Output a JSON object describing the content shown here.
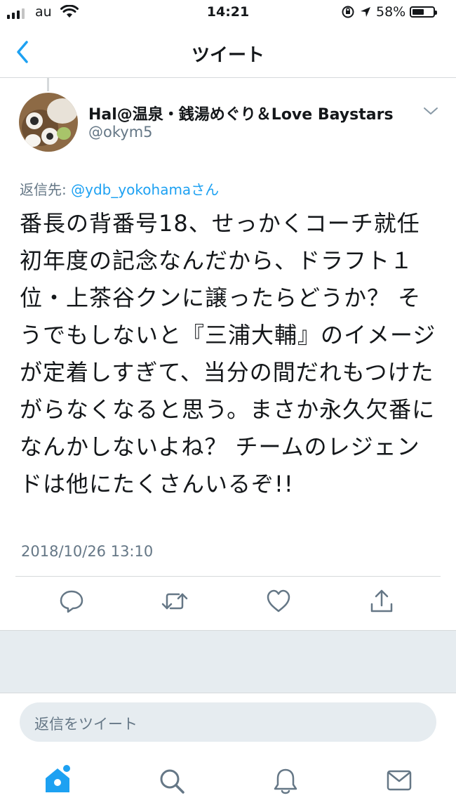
{
  "status_bar": {
    "carrier": "au",
    "time": "14:21",
    "battery": "58%",
    "battery_level": 0.58
  },
  "nav": {
    "title": "ツイート",
    "back_icon": "chevron-left-icon"
  },
  "tweet": {
    "display_name": "Hal@温泉・銭湯めぐり＆Love Baystars",
    "handle": "@okym5",
    "reply_prefix": "返信先:",
    "reply_target": "@ydb_yokohama",
    "reply_suffix": "さん",
    "text": "番長の背番号18、せっかくコーチ就任初年度の記念なんだから、ドラフト１位・上茶谷クンに譲ったらどうか？ そうでもしないと『三浦大輔』のイメージが定着しすぎて、当分の間だれもつけたがらなくなると思う。まさか永久欠番になんかしないよね？ チームのレジェンドは他にたくさんいるぞ!!",
    "timestamp": "2018/10/26 13:10"
  },
  "actions": [
    "reply-icon",
    "retweet-icon",
    "like-icon",
    "share-icon"
  ],
  "reply_input": {
    "placeholder": "返信をツイート"
  },
  "tabs": [
    "home-icon",
    "search-icon",
    "notifications-icon",
    "messages-icon"
  ],
  "colors": {
    "accent": "#1da1f2",
    "icon_gray": "#657786",
    "band": "#e6ecf0"
  }
}
